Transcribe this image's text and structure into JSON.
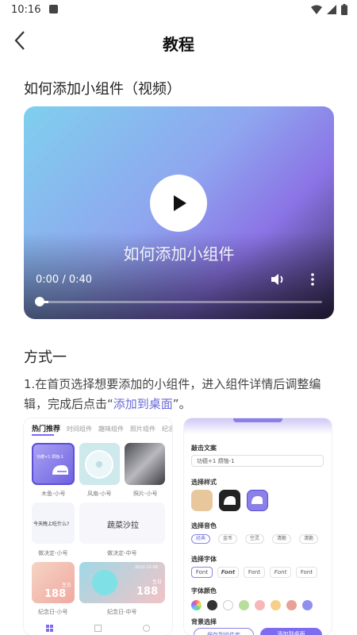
{
  "status": {
    "time": "10:16"
  },
  "header": {
    "title": "教程"
  },
  "section_video": {
    "title": "如何添加小组件（视频）"
  },
  "video": {
    "overlay_text": "如何添加小组件",
    "time": "0:00 / 0:40",
    "progress": 0.0
  },
  "section_method": {
    "title": "方式一"
  },
  "instruction": {
    "prefix": "1.在首页选择想要添加的小组件，进入组件详情后调整编辑，完成后点击“",
    "link": "添加到桌面",
    "suffix": "”。"
  },
  "left_shot": {
    "tabs": [
      "热门推荐",
      "时间组件",
      "趣味组件",
      "照片组件",
      "纪念"
    ],
    "captions": [
      "木鱼-小号",
      "风扇-小号",
      "照片-小号",
      "做决定-小号",
      "做决定-中号",
      "纪念日-小号",
      "纪念日-中号"
    ],
    "tile_texts": {
      "muyu": "功德+1 烦恼-1",
      "question": "今天晚上吃什么?",
      "salad": "蔬菜沙拉",
      "day_small": "188",
      "day_big": "188",
      "small_label": "生日",
      "big_label": "生日",
      "date": "2022-12-09"
    }
  },
  "right_shot": {
    "labels": [
      "敲击文案",
      "选择样式",
      "选择音色",
      "选择字体",
      "字体颜色",
      "背景选择"
    ],
    "field_value": "功德+1 烦恼-1",
    "tones": [
      "经典",
      "金币",
      "空灵",
      "清脆",
      "清脆"
    ],
    "fonts": [
      "Font",
      "Font",
      "Font",
      "Font",
      "Font"
    ],
    "colors": [
      "#f07dd2",
      "#333333",
      "#ffffff",
      "#b7de9c",
      "#f8b7b7",
      "#f6d08a",
      "#e9a097",
      "#8f8ff0"
    ],
    "buttons": [
      "保存到组件库",
      "添加到桌面"
    ]
  },
  "colors": {
    "accent": "#7d6cf0",
    "link": "#6b6ad8"
  }
}
